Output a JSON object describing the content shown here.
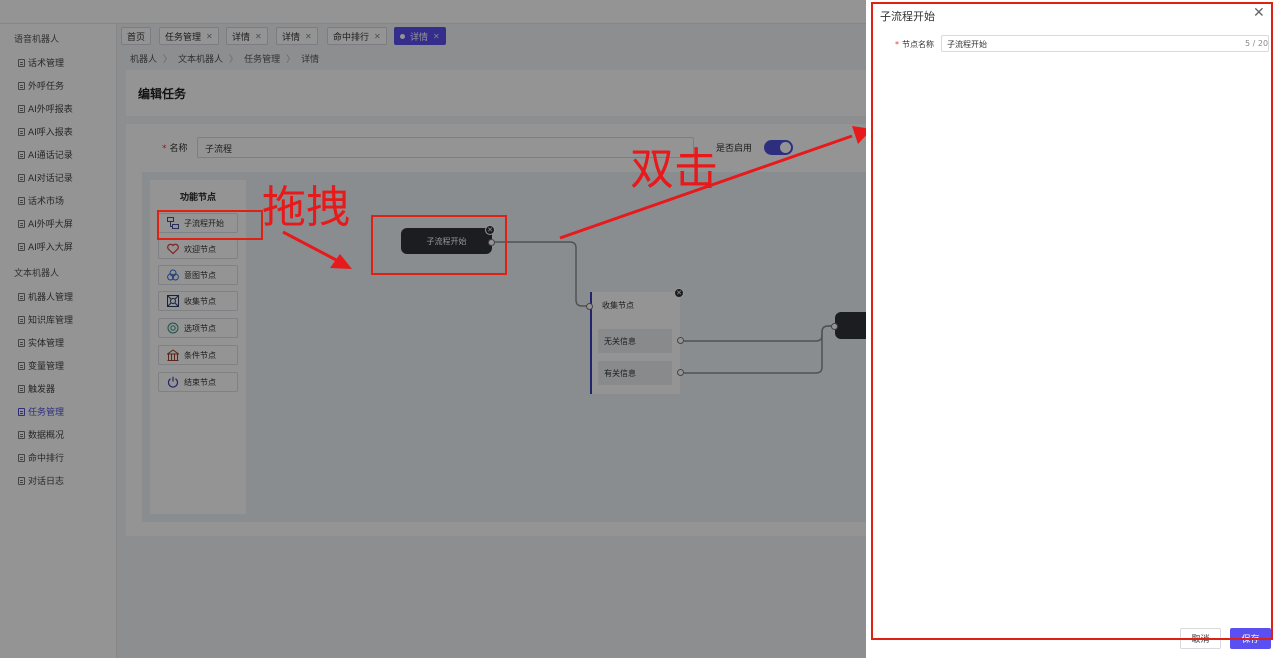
{
  "sidebar": {
    "groups": [
      {
        "label": "语音机器人",
        "items": [
          "话术管理",
          "外呼任务",
          "AI外呼报表",
          "AI呼入报表",
          "AI通话记录",
          "AI对话记录",
          "话术市场",
          "AI外呼大屏",
          "AI呼入大屏"
        ]
      },
      {
        "label": "文本机器人",
        "items": [
          "机器人管理",
          "知识库管理",
          "实体管理",
          "变量管理",
          "触发器",
          "任务管理",
          "数据概况",
          "命中排行",
          "对话日志"
        ]
      }
    ],
    "active_item": "任务管理"
  },
  "tabs": [
    {
      "label": "首页",
      "closable": false
    },
    {
      "label": "任务管理",
      "closable": true
    },
    {
      "label": "详情",
      "closable": true
    },
    {
      "label": "详情",
      "closable": true
    },
    {
      "label": "命中排行",
      "closable": true
    },
    {
      "label": "详情",
      "closable": true,
      "active": true
    }
  ],
  "breadcrumb": [
    "机器人",
    "文本机器人",
    "任务管理",
    "详情"
  ],
  "page": {
    "title": "编辑任务",
    "name_label": "名称",
    "name_value": "子流程",
    "enable_label": "是否启用",
    "enabled": true
  },
  "palette": {
    "title": "功能节点",
    "items": [
      {
        "label": "子流程开始",
        "icon": "subflow-icon"
      },
      {
        "label": "欢迎节点",
        "icon": "heart-icon"
      },
      {
        "label": "意图节点",
        "icon": "intent-icon"
      },
      {
        "label": "收集节点",
        "icon": "collect-icon"
      },
      {
        "label": "选项节点",
        "icon": "option-icon"
      },
      {
        "label": "条件节点",
        "icon": "condition-icon"
      },
      {
        "label": "结束节点",
        "icon": "power-icon"
      }
    ]
  },
  "flow": {
    "start_node": "子流程开始",
    "collect_node": {
      "title": "收集节点",
      "options": [
        "无关信息",
        "有关信息"
      ]
    }
  },
  "annotations": {
    "drag": "拖拽",
    "double_click": "双击",
    "color": "#e8191a"
  },
  "drawer": {
    "title": "子流程开始",
    "field_label": "节点名称",
    "field_value": "子流程开始",
    "counter": "5 / 20",
    "cancel": "取消",
    "save": "保存"
  },
  "colors": {
    "accent": "#5a4ff0",
    "node": "#2f3338"
  }
}
